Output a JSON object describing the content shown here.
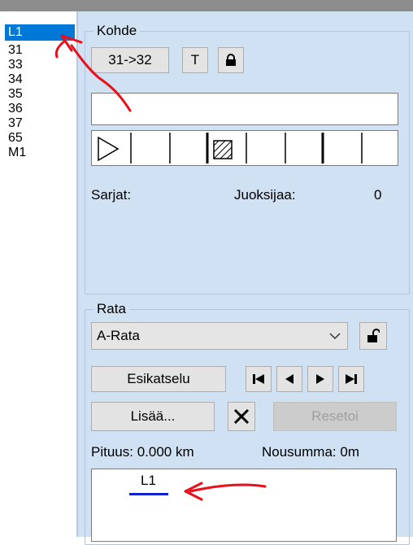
{
  "list": {
    "items": [
      "L1",
      "31",
      "33",
      "34",
      "35",
      "36",
      "37",
      "65",
      "M1"
    ],
    "selected": 0
  },
  "kohde": {
    "title": "Kohde",
    "swap_label": "31->32",
    "t_label": "T",
    "textbox_value": "",
    "sarjat_label": "Sarjat:",
    "juoksijaa_label": "Juoksijaa:",
    "juoksijaa_value": "0"
  },
  "rata": {
    "title": "Rata",
    "selected_course": "A-Rata",
    "preview_label": "Esikatselu",
    "add_label": "Lisää...",
    "reset_label": "Resetoi",
    "length_text": "Pituus: 0.000 km",
    "ascent_text": "Nousumma: 0m",
    "course_item": "L1"
  },
  "colors": {
    "panel": "#cfe1f3",
    "selection": "#0078d7",
    "annotation_red": "#e8101a",
    "course_line_blue": "#1020d0"
  }
}
